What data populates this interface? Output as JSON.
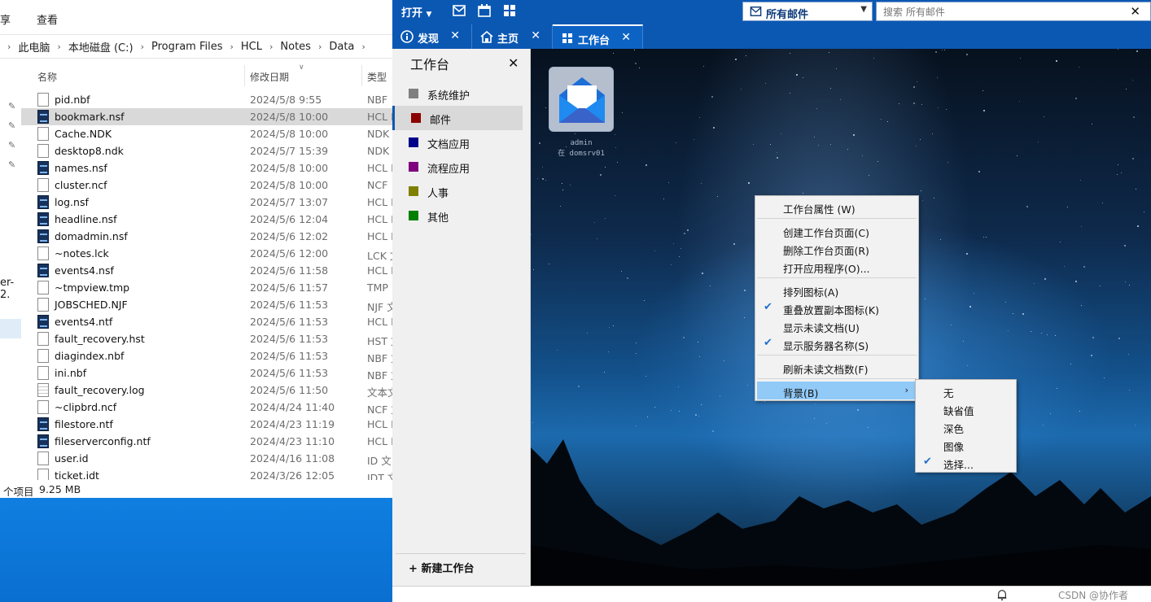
{
  "explorer": {
    "ribbon_tabs": [
      "享",
      "查看"
    ],
    "breadcrumb": [
      "此电脑",
      "本地磁盘 (C:)",
      "Program Files",
      "HCL",
      "Notes",
      "Data"
    ],
    "nav_truncated_label": "er-2.",
    "columns": {
      "name": "名称",
      "date": "修改日期",
      "type": "类型"
    },
    "files": [
      {
        "name": "pid.nbf",
        "date": "2024/5/8 9:55",
        "type": "NBF",
        "icon": "doc"
      },
      {
        "name": "bookmark.nsf",
        "date": "2024/5/8 10:00",
        "type": "HCL N",
        "icon": "nsf"
      },
      {
        "name": "Cache.NDK",
        "date": "2024/5/8 10:00",
        "type": "NDK",
        "icon": "doc"
      },
      {
        "name": "desktop8.ndk",
        "date": "2024/5/7 15:39",
        "type": "NDK",
        "icon": "doc"
      },
      {
        "name": "names.nsf",
        "date": "2024/5/8 10:00",
        "type": "HCL N",
        "icon": "nsf"
      },
      {
        "name": "cluster.ncf",
        "date": "2024/5/8 10:00",
        "type": "NCF",
        "icon": "doc"
      },
      {
        "name": "log.nsf",
        "date": "2024/5/7 13:07",
        "type": "HCL N",
        "icon": "nsf"
      },
      {
        "name": "headline.nsf",
        "date": "2024/5/6 12:04",
        "type": "HCL N",
        "icon": "nsf"
      },
      {
        "name": "domadmin.nsf",
        "date": "2024/5/6 12:02",
        "type": "HCL N",
        "icon": "nsf"
      },
      {
        "name": "~notes.lck",
        "date": "2024/5/6 12:00",
        "type": "LCK 文",
        "icon": "doc"
      },
      {
        "name": "events4.nsf",
        "date": "2024/5/6 11:58",
        "type": "HCL N",
        "icon": "nsf"
      },
      {
        "name": "~tmpview.tmp",
        "date": "2024/5/6 11:57",
        "type": "TMP",
        "icon": "doc"
      },
      {
        "name": "JOBSCHED.NJF",
        "date": "2024/5/6 11:53",
        "type": "NJF 文",
        "icon": "doc"
      },
      {
        "name": "events4.ntf",
        "date": "2024/5/6 11:53",
        "type": "HCL N",
        "icon": "nsf"
      },
      {
        "name": "fault_recovery.hst",
        "date": "2024/5/6 11:53",
        "type": "HST 文",
        "icon": "doc"
      },
      {
        "name": "diagindex.nbf",
        "date": "2024/5/6 11:53",
        "type": "NBF 文",
        "icon": "doc"
      },
      {
        "name": "ini.nbf",
        "date": "2024/5/6 11:53",
        "type": "NBF 文",
        "icon": "doc"
      },
      {
        "name": "fault_recovery.log",
        "date": "2024/5/6 11:50",
        "type": "文本文",
        "icon": "txt"
      },
      {
        "name": "~clipbrd.ncf",
        "date": "2024/4/24 11:40",
        "type": "NCF 文",
        "icon": "doc"
      },
      {
        "name": "filestore.ntf",
        "date": "2024/4/23 11:19",
        "type": "HCL N",
        "icon": "nsf"
      },
      {
        "name": "fileserverconfig.ntf",
        "date": "2024/4/23 11:10",
        "type": "HCL N",
        "icon": "nsf"
      },
      {
        "name": "user.id",
        "date": "2024/4/16 11:08",
        "type": "ID 文",
        "icon": "doc"
      },
      {
        "name": "ticket.idt",
        "date": "2024/3/26 12:05",
        "type": "IDT 文",
        "icon": "doc"
      }
    ],
    "status": {
      "items": "个项目",
      "selected_size": "9.25 MB"
    }
  },
  "notes": {
    "toolbar": {
      "open_label": "打开",
      "db_selector": "所有邮件",
      "search_placeholder": "搜索 所有邮件"
    },
    "tabs": [
      {
        "label": "发现",
        "icon": "info-icon"
      },
      {
        "label": "主页",
        "icon": "home-icon"
      },
      {
        "label": "工作台",
        "icon": "grid-icon"
      }
    ],
    "sidebar": {
      "title": "工作台",
      "categories": [
        {
          "label": "系统维护",
          "color": "#808080"
        },
        {
          "label": "邮件",
          "color": "#8b0000"
        },
        {
          "label": "文档应用",
          "color": "#00008b"
        },
        {
          "label": "流程应用",
          "color": "#800080"
        },
        {
          "label": "人事",
          "color": "#808000"
        },
        {
          "label": "其他",
          "color": "#008000"
        }
      ],
      "new_workspace": "新建工作台"
    },
    "tile_caption": [
      "admin",
      "在 domsrv01"
    ],
    "context_menu": {
      "items": [
        {
          "label": "工作台属性 (W)",
          "checked": false
        },
        {
          "label": "创建工作台页面(C)",
          "checked": false
        },
        {
          "label": "删除工作台页面(R)",
          "checked": false
        },
        {
          "label": "打开应用程序(O)...",
          "checked": false
        },
        {
          "label": "排列图标(A)",
          "checked": false
        },
        {
          "label": "重叠放置副本图标(K)",
          "checked": true
        },
        {
          "label": "显示未读文档(U)",
          "checked": false
        },
        {
          "label": "显示服务器名称(S)",
          "checked": true
        },
        {
          "label": "刷新未读文档数(F)",
          "checked": false
        },
        {
          "label": "背景(B)",
          "checked": false,
          "has_submenu": true
        }
      ],
      "background_submenu": [
        {
          "label": "无",
          "checked": false
        },
        {
          "label": "缺省值",
          "checked": false
        },
        {
          "label": "深色",
          "checked": false
        },
        {
          "label": "图像",
          "checked": false
        },
        {
          "label": "选择...",
          "checked": true
        }
      ]
    },
    "watermark": "CSDN @协作者"
  },
  "colors": {
    "notes_blue": "#0b58b3",
    "menu_highlight": "#91c9f7",
    "check_blue": "#1f6fd0"
  }
}
